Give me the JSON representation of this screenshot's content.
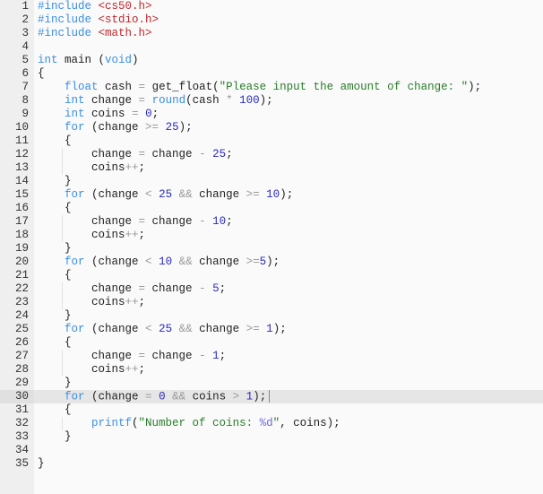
{
  "editor": {
    "language": "c",
    "active_line": 30,
    "colors": {
      "keyword": "#3b8ee5",
      "include_path": "#c0272d",
      "string": "#2a7d2a",
      "number": "#2b2bbf",
      "operator": "#999999",
      "gutter_bg": "#efefef",
      "active_line_bg": "#e6e6e6"
    },
    "lines": [
      {
        "n": "1",
        "tokens": [
          [
            "pp",
            "#include"
          ],
          [
            "plain",
            " "
          ],
          [
            "inc",
            "<cs50.h>"
          ]
        ]
      },
      {
        "n": "2",
        "tokens": [
          [
            "pp",
            "#include"
          ],
          [
            "plain",
            " "
          ],
          [
            "inc",
            "<stdio.h>"
          ]
        ]
      },
      {
        "n": "3",
        "tokens": [
          [
            "pp",
            "#include"
          ],
          [
            "plain",
            " "
          ],
          [
            "inc",
            "<math.h>"
          ]
        ]
      },
      {
        "n": "4",
        "tokens": []
      },
      {
        "n": "5",
        "tokens": [
          [
            "kw",
            "int"
          ],
          [
            "plain",
            " main ("
          ],
          [
            "kw",
            "void"
          ],
          [
            "plain",
            ")"
          ]
        ]
      },
      {
        "n": "6",
        "tokens": [
          [
            "plain",
            "{"
          ]
        ]
      },
      {
        "n": "7",
        "tokens": [
          [
            "plain",
            "    "
          ],
          [
            "kw",
            "float"
          ],
          [
            "plain",
            " cash "
          ],
          [
            "op",
            "="
          ],
          [
            "plain",
            " get_float("
          ],
          [
            "str",
            "\"Please input the amount of change: \""
          ],
          [
            "plain",
            ");"
          ]
        ]
      },
      {
        "n": "8",
        "tokens": [
          [
            "plain",
            "    "
          ],
          [
            "kw",
            "int"
          ],
          [
            "plain",
            " change "
          ],
          [
            "op",
            "="
          ],
          [
            "plain",
            " "
          ],
          [
            "kw",
            "round"
          ],
          [
            "plain",
            "(cash "
          ],
          [
            "op",
            "*"
          ],
          [
            "plain",
            " "
          ],
          [
            "num",
            "100"
          ],
          [
            "plain",
            ");"
          ]
        ]
      },
      {
        "n": "9",
        "tokens": [
          [
            "plain",
            "    "
          ],
          [
            "kw",
            "int"
          ],
          [
            "plain",
            " coins "
          ],
          [
            "op",
            "="
          ],
          [
            "plain",
            " "
          ],
          [
            "num",
            "0"
          ],
          [
            "plain",
            ";"
          ]
        ]
      },
      {
        "n": "10",
        "tokens": [
          [
            "plain",
            "    "
          ],
          [
            "kw",
            "for"
          ],
          [
            "plain",
            " (change "
          ],
          [
            "op",
            ">="
          ],
          [
            "plain",
            " "
          ],
          [
            "num",
            "25"
          ],
          [
            "plain",
            ");"
          ]
        ]
      },
      {
        "n": "11",
        "tokens": [
          [
            "plain",
            "    {"
          ]
        ]
      },
      {
        "n": "12",
        "tokens": [
          [
            "plain",
            "        change "
          ],
          [
            "op",
            "="
          ],
          [
            "plain",
            " change "
          ],
          [
            "op",
            "-"
          ],
          [
            "plain",
            " "
          ],
          [
            "num",
            "25"
          ],
          [
            "plain",
            ";"
          ]
        ]
      },
      {
        "n": "13",
        "tokens": [
          [
            "plain",
            "        coins"
          ],
          [
            "op",
            "++"
          ],
          [
            "plain",
            ";"
          ]
        ]
      },
      {
        "n": "14",
        "tokens": [
          [
            "plain",
            "    }"
          ]
        ]
      },
      {
        "n": "15",
        "tokens": [
          [
            "plain",
            "    "
          ],
          [
            "kw",
            "for"
          ],
          [
            "plain",
            " (change "
          ],
          [
            "op",
            "<"
          ],
          [
            "plain",
            " "
          ],
          [
            "num",
            "25"
          ],
          [
            "plain",
            " "
          ],
          [
            "op",
            "&&"
          ],
          [
            "plain",
            " change "
          ],
          [
            "op",
            ">="
          ],
          [
            "plain",
            " "
          ],
          [
            "num",
            "10"
          ],
          [
            "plain",
            ");"
          ]
        ]
      },
      {
        "n": "16",
        "tokens": [
          [
            "plain",
            "    {"
          ]
        ]
      },
      {
        "n": "17",
        "tokens": [
          [
            "plain",
            "        change "
          ],
          [
            "op",
            "="
          ],
          [
            "plain",
            " change "
          ],
          [
            "op",
            "-"
          ],
          [
            "plain",
            " "
          ],
          [
            "num",
            "10"
          ],
          [
            "plain",
            ";"
          ]
        ]
      },
      {
        "n": "18",
        "tokens": [
          [
            "plain",
            "        coins"
          ],
          [
            "op",
            "++"
          ],
          [
            "plain",
            ";"
          ]
        ]
      },
      {
        "n": "19",
        "tokens": [
          [
            "plain",
            "    }"
          ]
        ]
      },
      {
        "n": "20",
        "tokens": [
          [
            "plain",
            "    "
          ],
          [
            "kw",
            "for"
          ],
          [
            "plain",
            " (change "
          ],
          [
            "op",
            "<"
          ],
          [
            "plain",
            " "
          ],
          [
            "num",
            "10"
          ],
          [
            "plain",
            " "
          ],
          [
            "op",
            "&&"
          ],
          [
            "plain",
            " change "
          ],
          [
            "op",
            ">="
          ],
          [
            "num",
            "5"
          ],
          [
            "plain",
            ");"
          ]
        ]
      },
      {
        "n": "21",
        "tokens": [
          [
            "plain",
            "    {"
          ]
        ]
      },
      {
        "n": "22",
        "tokens": [
          [
            "plain",
            "        change "
          ],
          [
            "op",
            "="
          ],
          [
            "plain",
            " change "
          ],
          [
            "op",
            "-"
          ],
          [
            "plain",
            " "
          ],
          [
            "num",
            "5"
          ],
          [
            "plain",
            ";"
          ]
        ]
      },
      {
        "n": "23",
        "tokens": [
          [
            "plain",
            "        coins"
          ],
          [
            "op",
            "++"
          ],
          [
            "plain",
            ";"
          ]
        ]
      },
      {
        "n": "24",
        "tokens": [
          [
            "plain",
            "    }"
          ]
        ]
      },
      {
        "n": "25",
        "tokens": [
          [
            "plain",
            "    "
          ],
          [
            "kw",
            "for"
          ],
          [
            "plain",
            " (change "
          ],
          [
            "op",
            "<"
          ],
          [
            "plain",
            " "
          ],
          [
            "num",
            "25"
          ],
          [
            "plain",
            " "
          ],
          [
            "op",
            "&&"
          ],
          [
            "plain",
            " change "
          ],
          [
            "op",
            ">="
          ],
          [
            "plain",
            " "
          ],
          [
            "num",
            "1"
          ],
          [
            "plain",
            ");"
          ]
        ]
      },
      {
        "n": "26",
        "tokens": [
          [
            "plain",
            "    {"
          ]
        ]
      },
      {
        "n": "27",
        "tokens": [
          [
            "plain",
            "        change "
          ],
          [
            "op",
            "="
          ],
          [
            "plain",
            " change "
          ],
          [
            "op",
            "-"
          ],
          [
            "plain",
            " "
          ],
          [
            "num",
            "1"
          ],
          [
            "plain",
            ";"
          ]
        ]
      },
      {
        "n": "28",
        "tokens": [
          [
            "plain",
            "        coins"
          ],
          [
            "op",
            "++"
          ],
          [
            "plain",
            ";"
          ]
        ]
      },
      {
        "n": "29",
        "tokens": [
          [
            "plain",
            "    }"
          ]
        ]
      },
      {
        "n": "30",
        "tokens": [
          [
            "plain",
            "    "
          ],
          [
            "kw",
            "for"
          ],
          [
            "plain",
            " (change "
          ],
          [
            "op",
            "="
          ],
          [
            "plain",
            " "
          ],
          [
            "num",
            "0"
          ],
          [
            "plain",
            " "
          ],
          [
            "op",
            "&&"
          ],
          [
            "plain",
            " coins "
          ],
          [
            "op",
            ">"
          ],
          [
            "plain",
            " "
          ],
          [
            "num",
            "1"
          ],
          [
            "plain",
            ");"
          ]
        ]
      },
      {
        "n": "31",
        "tokens": [
          [
            "plain",
            "    {"
          ]
        ]
      },
      {
        "n": "32",
        "tokens": [
          [
            "plain",
            "        "
          ],
          [
            "kw",
            "printf"
          ],
          [
            "plain",
            "("
          ],
          [
            "str",
            "\"Number of coins: "
          ],
          [
            "fmt",
            "%d"
          ],
          [
            "str",
            "\""
          ],
          [
            "plain",
            ", coins);"
          ]
        ]
      },
      {
        "n": "33",
        "tokens": [
          [
            "plain",
            "    }"
          ]
        ]
      },
      {
        "n": "34",
        "tokens": []
      },
      {
        "n": "35",
        "tokens": [
          [
            "plain",
            "}"
          ]
        ]
      }
    ]
  }
}
